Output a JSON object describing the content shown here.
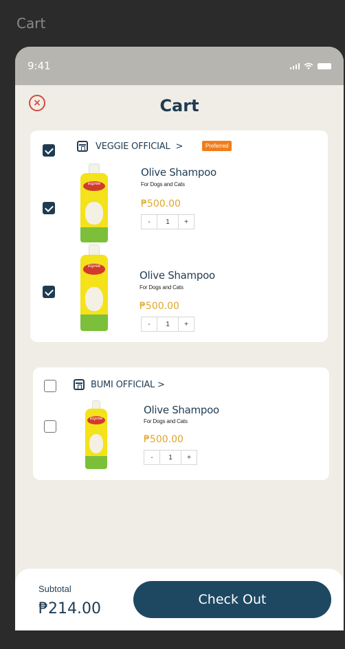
{
  "frame": {
    "title": "Cart"
  },
  "status_bar": {
    "time": "9:41"
  },
  "header": {
    "title": "Cart",
    "close_icon": "close-circle-icon",
    "close_glyph": "×"
  },
  "stores": [
    {
      "name": "VEGGIE OFFICIAL",
      "chevron": ">",
      "badge": "Preferred",
      "checked": true,
      "items": [
        {
          "name": "Olive Shampoo",
          "subtitle": "For Dogs and Cats",
          "price": "₱500.00",
          "qty": "1",
          "checked": true,
          "brand": "espree"
        },
        {
          "name": "Olive Shampoo",
          "subtitle": "For Dogs and Cats",
          "price": "₱500.00",
          "qty": "1",
          "checked": true,
          "brand": "espree"
        }
      ]
    },
    {
      "name": "BUMI OFFICIAL",
      "chevron": ">",
      "checked": false,
      "items": [
        {
          "name": "Olive Shampoo",
          "subtitle": "For Dogs and Cats",
          "price": "₱500.00",
          "qty": "1",
          "checked": false,
          "brand": "espree"
        }
      ]
    }
  ],
  "stepper": {
    "minus": "-",
    "plus": "+"
  },
  "footer": {
    "subtotal_label": "Subtotal",
    "subtotal_value": "₱214.00",
    "checkout_label": "Check Out"
  },
  "colors": {
    "accent": "#1e4862",
    "price": "#e0a52a",
    "badge": "#f07d1d",
    "close": "#d24a3f"
  }
}
